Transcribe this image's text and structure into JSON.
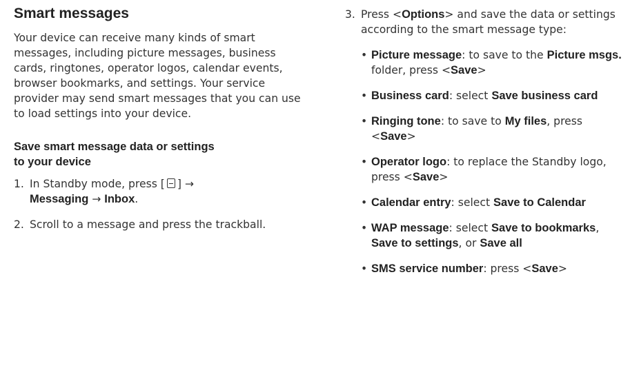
{
  "left": {
    "title": "Smart messages",
    "intro": "Your device can receive many kinds of smart messages, including picture messages, business cards, ringtones, operator logos, calendar events, browser bookmarks, and settings. Your service provider may send smart messages that you can use to load settings into your device.",
    "subtitle_line1": "Save smart message data or settings",
    "subtitle_line2": "to your device",
    "step1": {
      "number": "1.",
      "text_a": "In Standby mode, press [",
      "icon": "menu-key-icon",
      "text_b": "] →",
      "bold_a": "Messaging",
      "arrow": " → ",
      "bold_b": "Inbox",
      "end": "."
    },
    "step2": {
      "number": "2.",
      "text": "Scroll to a message and press the trackball."
    }
  },
  "right": {
    "step3": {
      "number": "3.",
      "text_a": "Press <",
      "bold": "Options",
      "text_b": "> and save the data or settings according to the smart message type:"
    },
    "bullets": [
      {
        "label": "Picture message",
        "t1": ": to save to the ",
        "b1": "Picture msgs.",
        "t2": " folder, press <",
        "b2": "Save",
        "t3": ">"
      },
      {
        "label": "Business card",
        "t1": ": select ",
        "b1": "Save business card",
        "t2": "",
        "b2": "",
        "t3": ""
      },
      {
        "label": "Ringing tone",
        "t1": ": to save to ",
        "b1": "My files",
        "t2": ", press <",
        "b2": "Save",
        "t3": ">"
      },
      {
        "label": "Operator logo",
        "t1": ": to replace the Standby logo, press <",
        "b1": "Save",
        "t2": ">",
        "b2": "",
        "t3": ""
      },
      {
        "label": "Calendar entry",
        "t1": ": select ",
        "b1": "Save to Calendar",
        "t2": "",
        "b2": "",
        "t3": ""
      },
      {
        "label": "WAP message",
        "t1": ": select ",
        "b1": "Save to bookmarks",
        "t2": ", ",
        "b2": "Save to settings",
        "t3": ", or ",
        "b3": "Save all"
      },
      {
        "label": "SMS service number",
        "t1": ": press <",
        "b1": "Save",
        "t2": ">",
        "b2": "",
        "t3": ""
      }
    ]
  }
}
